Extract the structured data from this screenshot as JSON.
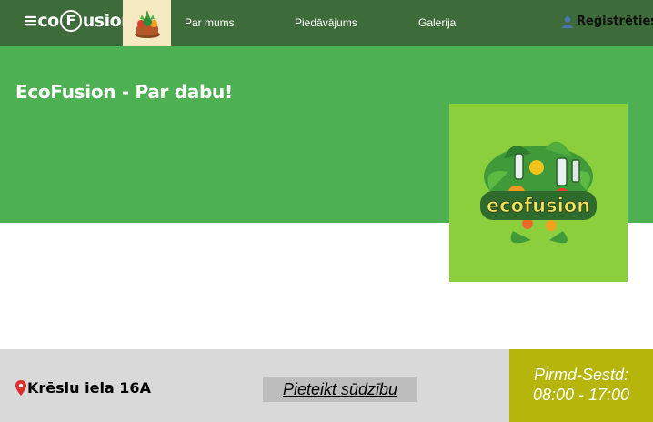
{
  "nav": {
    "brand_prefix": "≡co",
    "brand_f": "F",
    "brand_suffix": "usion",
    "links": [
      "Par mums",
      "Piedāvājums",
      "Galerija"
    ],
    "register_label": "Reģistrēties"
  },
  "hero": {
    "title": "EcoFusion - Par dabu!",
    "logo_text": "ecofusion"
  },
  "footer": {
    "address": "Krēslu iela 16A",
    "complaint_button": "Pieteikt sūdzību",
    "hours_days": "Pirmd-Sestd:",
    "hours_time": "08:00 - 17:00"
  },
  "colors": {
    "nav_bg": "#3e6b3a",
    "hero_bg": "#4db052",
    "logo_card_bg": "#8ccf3d",
    "footer_bg": "#d9d9d9",
    "hours_bg": "#b5b50b"
  }
}
